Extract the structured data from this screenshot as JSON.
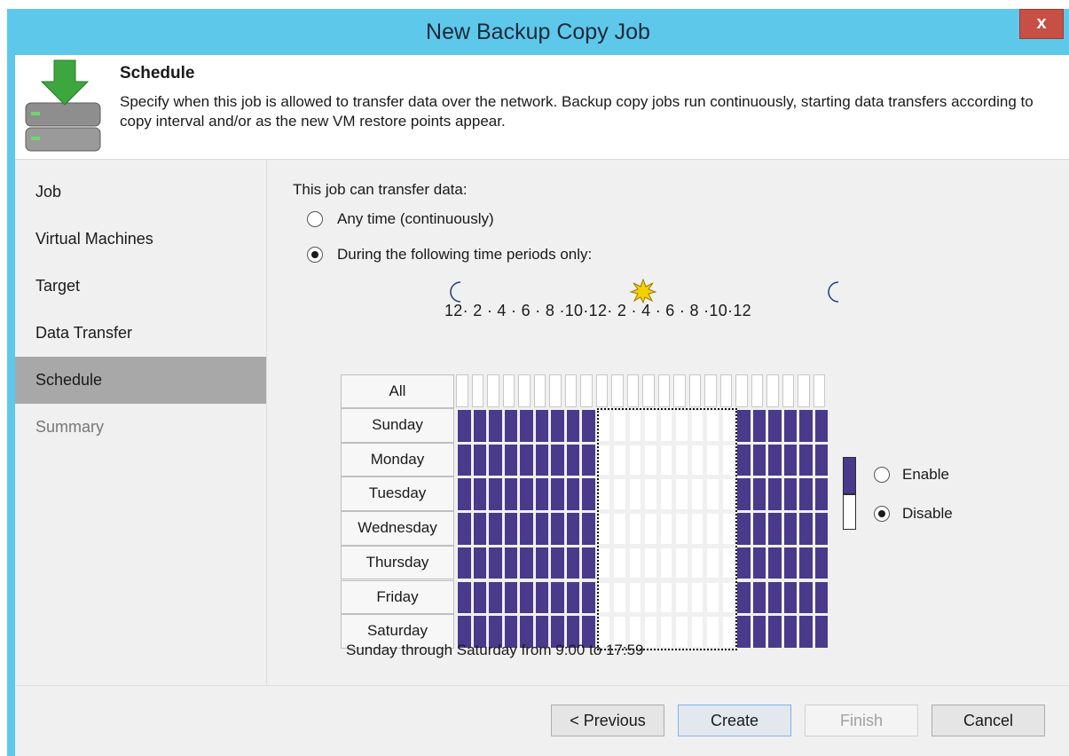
{
  "window": {
    "title": "New Backup Copy Job",
    "close_label": "x"
  },
  "header": {
    "title": "Schedule",
    "description": "Specify when this job is allowed to transfer data over the network. Backup copy jobs run continuously, starting data transfers according to copy interval and/or as the new VM restore points appear."
  },
  "sidebar": {
    "items": [
      {
        "label": "Job"
      },
      {
        "label": "Virtual Machines"
      },
      {
        "label": "Target"
      },
      {
        "label": "Data Transfer"
      },
      {
        "label": "Schedule"
      },
      {
        "label": "Summary"
      }
    ],
    "active": "Schedule"
  },
  "schedule": {
    "prompt": "This job can transfer data:",
    "option_anytime": "Any time (continuously)",
    "option_periods": "During the following time periods only:",
    "selected_option": "periods",
    "hour_scale": "12· 2 · 4 · 6 · 8 ·10·12· 2 · 4 · 6 · 8 ·10·12",
    "all_label": "All",
    "days": [
      "Sunday",
      "Monday",
      "Tuesday",
      "Wednesday",
      "Thursday",
      "Friday",
      "Saturday"
    ],
    "disabled_hours_start": 9,
    "disabled_hours_end": 17,
    "enable_label": "Enable",
    "disable_label": "Disable",
    "selected_mode": "Disable",
    "summary": "Sunday through Saturday from 9:00 to 17:59",
    "colors": {
      "enabled": "#4a3a8c",
      "disabled": "#ffffff"
    }
  },
  "footer": {
    "previous": "< Previous",
    "create": "Create",
    "finish": "Finish",
    "cancel": "Cancel"
  }
}
